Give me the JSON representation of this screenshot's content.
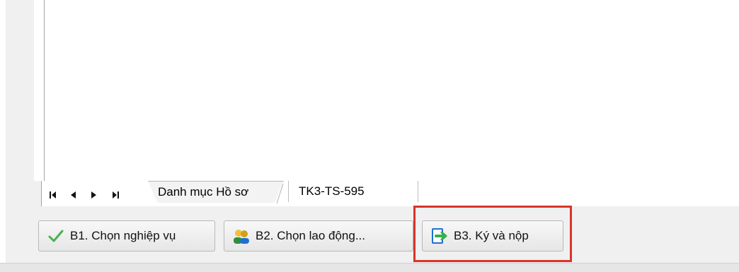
{
  "sheet_tabs": [
    {
      "label": "Danh mục Hồ sơ",
      "active": false
    },
    {
      "label": "TK3-TS-595",
      "active": true
    }
  ],
  "navigation": {
    "first_icon": "first-page-icon",
    "prev_icon": "previous-icon",
    "next_icon": "next-icon",
    "last_icon": "last-page-icon"
  },
  "actions": [
    {
      "label": "B1. Chọn nghiệp vụ",
      "icon": "checkmark-icon"
    },
    {
      "label": "B2. Chọn lao động...",
      "icon": "users-icon"
    },
    {
      "label": "B3. Ký và nộp",
      "icon": "submit-icon"
    }
  ],
  "highlight": {
    "target": "B3. Ký và nộp",
    "color": "#d9342a"
  },
  "colors": {
    "checkmark": "#4caf50",
    "submit_icon": "#1f6fd1",
    "submit_arrow": "#36b04a"
  }
}
